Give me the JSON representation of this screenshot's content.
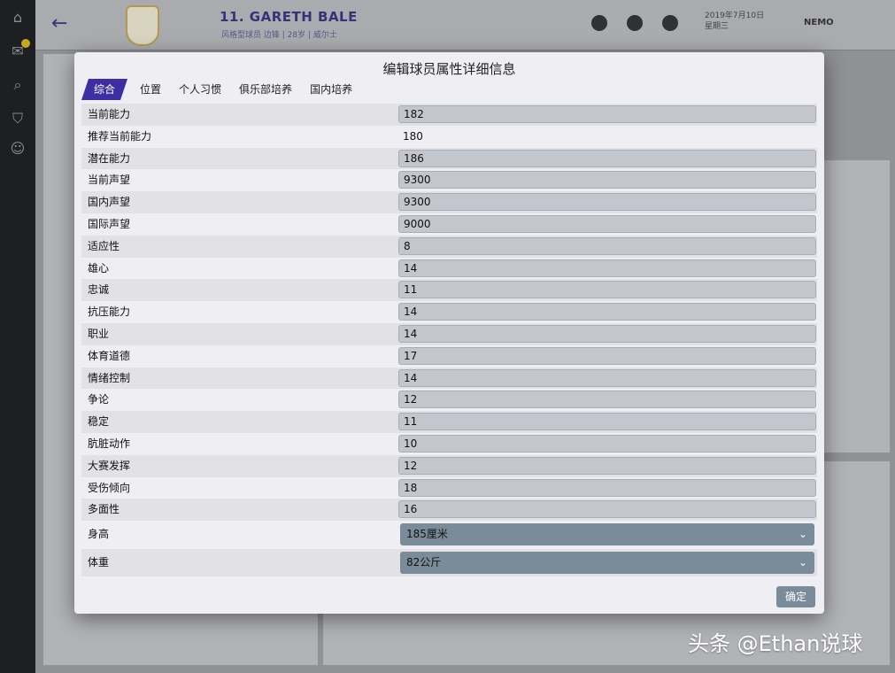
{
  "background": {
    "player_name": "11. GARETH BALE",
    "player_sub": "风格型球员 边锋 | 28岁 | 威尔士",
    "date_text": "2019年7月10日\n星期三",
    "user_name": "NEMO"
  },
  "modal": {
    "title": "编辑球员属性详细信息",
    "tabs": [
      {
        "label": "综合",
        "active": true
      },
      {
        "label": "位置",
        "active": false
      },
      {
        "label": "个人习惯",
        "active": false
      },
      {
        "label": "俱乐部培养",
        "active": false
      },
      {
        "label": "国内培养",
        "active": false
      }
    ],
    "rows": [
      {
        "label": "当前能力",
        "value": "182",
        "kind": "input"
      },
      {
        "label": "推荐当前能力",
        "value": "180",
        "kind": "static"
      },
      {
        "label": "潜在能力",
        "value": "186",
        "kind": "input"
      },
      {
        "label": "当前声望",
        "value": "9300",
        "kind": "input"
      },
      {
        "label": "国内声望",
        "value": "9300",
        "kind": "input"
      },
      {
        "label": "国际声望",
        "value": "9000",
        "kind": "input"
      },
      {
        "label": "适应性",
        "value": "8",
        "kind": "input"
      },
      {
        "label": "雄心",
        "value": "14",
        "kind": "input"
      },
      {
        "label": "忠诚",
        "value": "11",
        "kind": "input"
      },
      {
        "label": "抗压能力",
        "value": "14",
        "kind": "input"
      },
      {
        "label": "职业",
        "value": "14",
        "kind": "input"
      },
      {
        "label": "体育道德",
        "value": "17",
        "kind": "input"
      },
      {
        "label": "情绪控制",
        "value": "14",
        "kind": "input"
      },
      {
        "label": "争论",
        "value": "12",
        "kind": "input"
      },
      {
        "label": "稳定",
        "value": "11",
        "kind": "input"
      },
      {
        "label": "肮脏动作",
        "value": "10",
        "kind": "input"
      },
      {
        "label": "大赛发挥",
        "value": "12",
        "kind": "input"
      },
      {
        "label": "受伤倾向",
        "value": "18",
        "kind": "input"
      },
      {
        "label": "多面性",
        "value": "16",
        "kind": "input"
      }
    ],
    "height": {
      "label": "身高",
      "value": "185厘米"
    },
    "weight": {
      "label": "体重",
      "value": "82公斤"
    },
    "ok_label": "确定"
  },
  "watermark": "头条 @Ethan说球",
  "colors": {
    "accent_tab": "#3d2fa3",
    "button": "#7a8b99",
    "input_bg": "#c3c6cd"
  }
}
